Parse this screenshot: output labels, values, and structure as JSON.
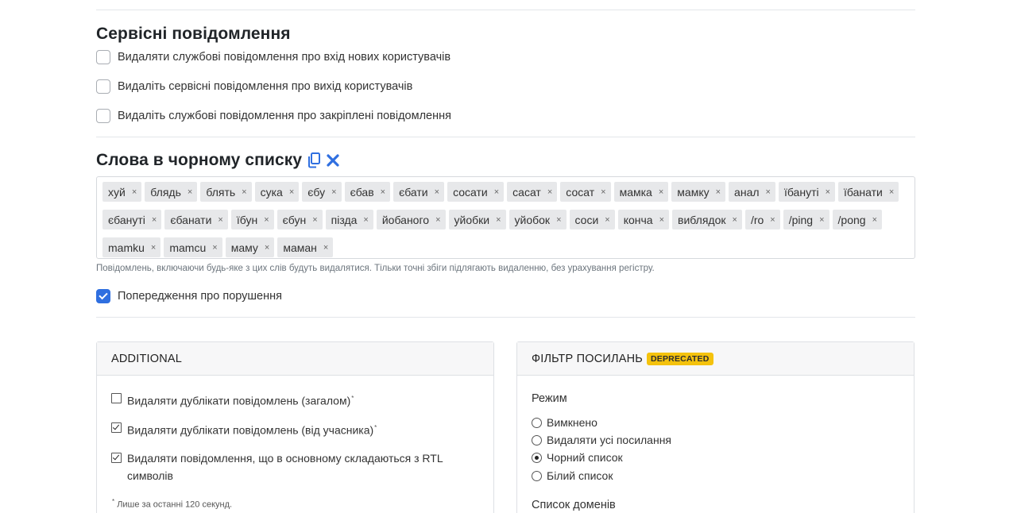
{
  "service_messages": {
    "title": "Сервісні повідомлення",
    "options": [
      {
        "label": "Видаляти службові повідомлення про вхід нових користувачів",
        "checked": false
      },
      {
        "label": "Видаліть сервісні повідомлення про вихід користувачів",
        "checked": false
      },
      {
        "label": "Видаліть службові повідомлення про закріплені повідомлення",
        "checked": false
      }
    ]
  },
  "blacklist": {
    "title": "Слова в чорному списку",
    "copy_icon": "copy-icon",
    "clear_icon": "close-icon",
    "accent_color": "#2f6fe0",
    "remove_symbol": "×",
    "words": [
      "хуй",
      "блядь",
      "блять",
      "сука",
      "єбу",
      "єбав",
      "єбати",
      "сосати",
      "сасат",
      "сосат",
      "мамка",
      "мамку",
      "анал",
      "їбануті",
      "їбанати",
      "єбануті",
      "єбанати",
      "їбун",
      "єбун",
      "пізда",
      "йобаного",
      "уйобки",
      "уйобок",
      "соси",
      "конча",
      "виблядок",
      "/ro",
      "/ping",
      "/pong",
      "mamku",
      "mamcu",
      "маму",
      "маман"
    ],
    "help": "Повідомлень, включаючи будь-яке з цих слів будуть видалятися. Тільки точні збіги підлягають видаленню, без урахування регістру.",
    "warning_label": "Попередження про порушення",
    "warning_checked": true
  },
  "additional": {
    "title": "ADDITIONAL",
    "options": [
      {
        "label": "Видаляти дублікати повідомлень (загалом)",
        "mark": "*",
        "checked": false
      },
      {
        "label": "Видаляти дублікати повідомлень (від учасника)",
        "mark": "*",
        "checked": true
      },
      {
        "label": "Видаляти повідомлення, що в основному складаються з RTL",
        "label2": "символів",
        "checked": true
      }
    ],
    "footnote_mark": "*",
    "footnote": "Лише за останні 120 секунд."
  },
  "link_filter": {
    "title": "ФІЛЬТР ПОСИЛАНЬ",
    "badge": "DEPRECATED",
    "badge_color": "#f4c20d",
    "mode_label": "Режим",
    "modes": [
      {
        "label": "Вимкнено",
        "selected": false
      },
      {
        "label": "Видаляти усі посилання",
        "selected": false
      },
      {
        "label": "Чорний список",
        "selected": true
      },
      {
        "label": "Білий список",
        "selected": false
      }
    ],
    "domains_label": "Список доменів"
  }
}
